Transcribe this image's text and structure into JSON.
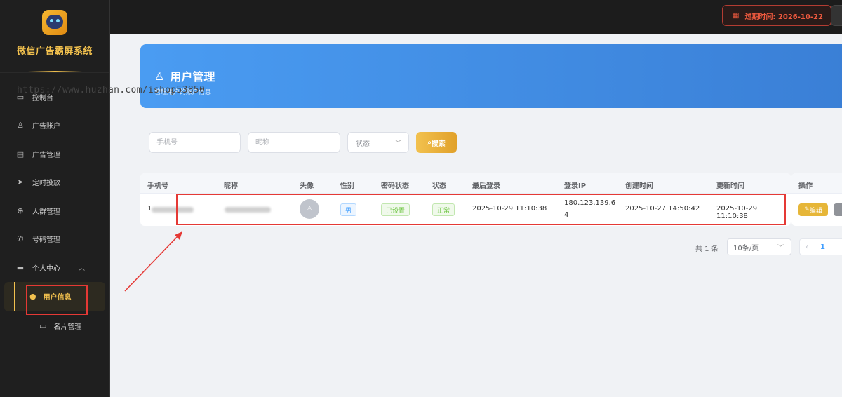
{
  "app": {
    "title": "微信广告霸屏系统"
  },
  "topbar": {
    "expire_text": "过期时间: 2026-10-22",
    "colors": {
      "expire": "#f05a3f"
    }
  },
  "sidebar": {
    "items": [
      {
        "label": "控制台",
        "icon": "desktop-icon"
      },
      {
        "label": "广告账户",
        "icon": "user-icon"
      },
      {
        "label": "广告管理",
        "icon": "document-icon"
      },
      {
        "label": "定时投放",
        "icon": "send-icon"
      },
      {
        "label": "人群管理",
        "icon": "group-icon"
      },
      {
        "label": "号码管理",
        "icon": "phone-icon"
      },
      {
        "label": "个人中心",
        "icon": "profile-card-icon",
        "expanded": true
      }
    ],
    "sub_items": [
      {
        "label": "用户信息",
        "icon": "user-icon",
        "active": true
      },
      {
        "label": "名片管理",
        "icon": "card-icon",
        "active": false
      }
    ]
  },
  "banner": {
    "title": "用户管理",
    "subtitle": "管理用户的账户信息"
  },
  "watermark": "https://www.huzhan.com/ishop53850",
  "filters": {
    "phone_placeholder": "手机号",
    "nickname_placeholder": "昵称",
    "status_placeholder": "状态",
    "search_label": "搜索"
  },
  "table": {
    "columns": [
      "手机号",
      "昵称",
      "头像",
      "性别",
      "密码状态",
      "状态",
      "最后登录",
      "登录IP",
      "创建时间",
      "更新时间",
      "操作"
    ],
    "rows": [
      {
        "phone_prefix": "1",
        "gender": "男",
        "password_status": "已设置",
        "status": "正常",
        "last_login": "2025-10-29 11:10:38",
        "ip_line1": "180.123.139.6",
        "ip_line2": "4",
        "created": "2025-10-27 14:50:42",
        "updated": "2025-10-29 11:10:38",
        "edit_label": "编辑"
      }
    ]
  },
  "pagination": {
    "total_text": "共 1 条",
    "page_size": "10条/页",
    "current_page": "1"
  }
}
